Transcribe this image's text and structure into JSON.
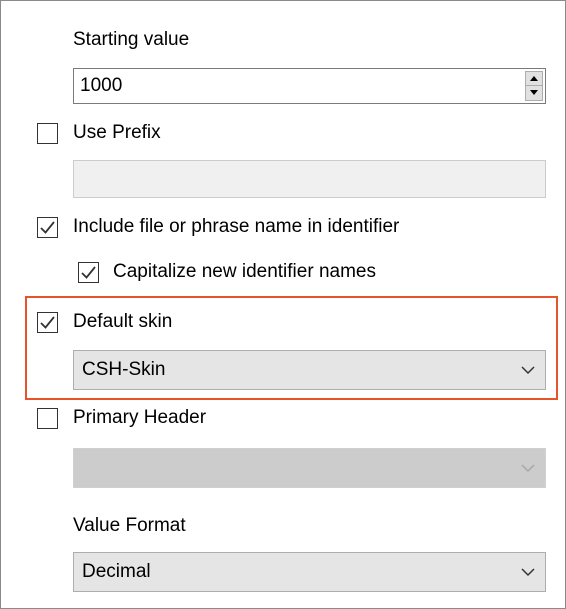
{
  "starting_value": {
    "label": "Starting value",
    "value": "1000"
  },
  "use_prefix": {
    "label": "Use Prefix",
    "checked": false,
    "input_value": ""
  },
  "include_name": {
    "label": "Include file or phrase name in identifier",
    "checked": true
  },
  "capitalize": {
    "label": "Capitalize new identifier names",
    "checked": true
  },
  "default_skin": {
    "label": "Default skin",
    "checked": true,
    "selected": "CSH-Skin"
  },
  "primary_header": {
    "label": "Primary Header",
    "checked": false,
    "selected": ""
  },
  "value_format": {
    "label": "Value Format",
    "selected": "Decimal"
  },
  "colors": {
    "highlight": "#e8542a",
    "combo_bg": "#e5e5e5",
    "combo_disabled_bg": "#cccccc"
  },
  "icons": {
    "check": "check-mark-icon",
    "dropdown": "chevron-down-icon",
    "spin_up": "triangle-up-icon",
    "spin_down": "triangle-down-icon"
  }
}
